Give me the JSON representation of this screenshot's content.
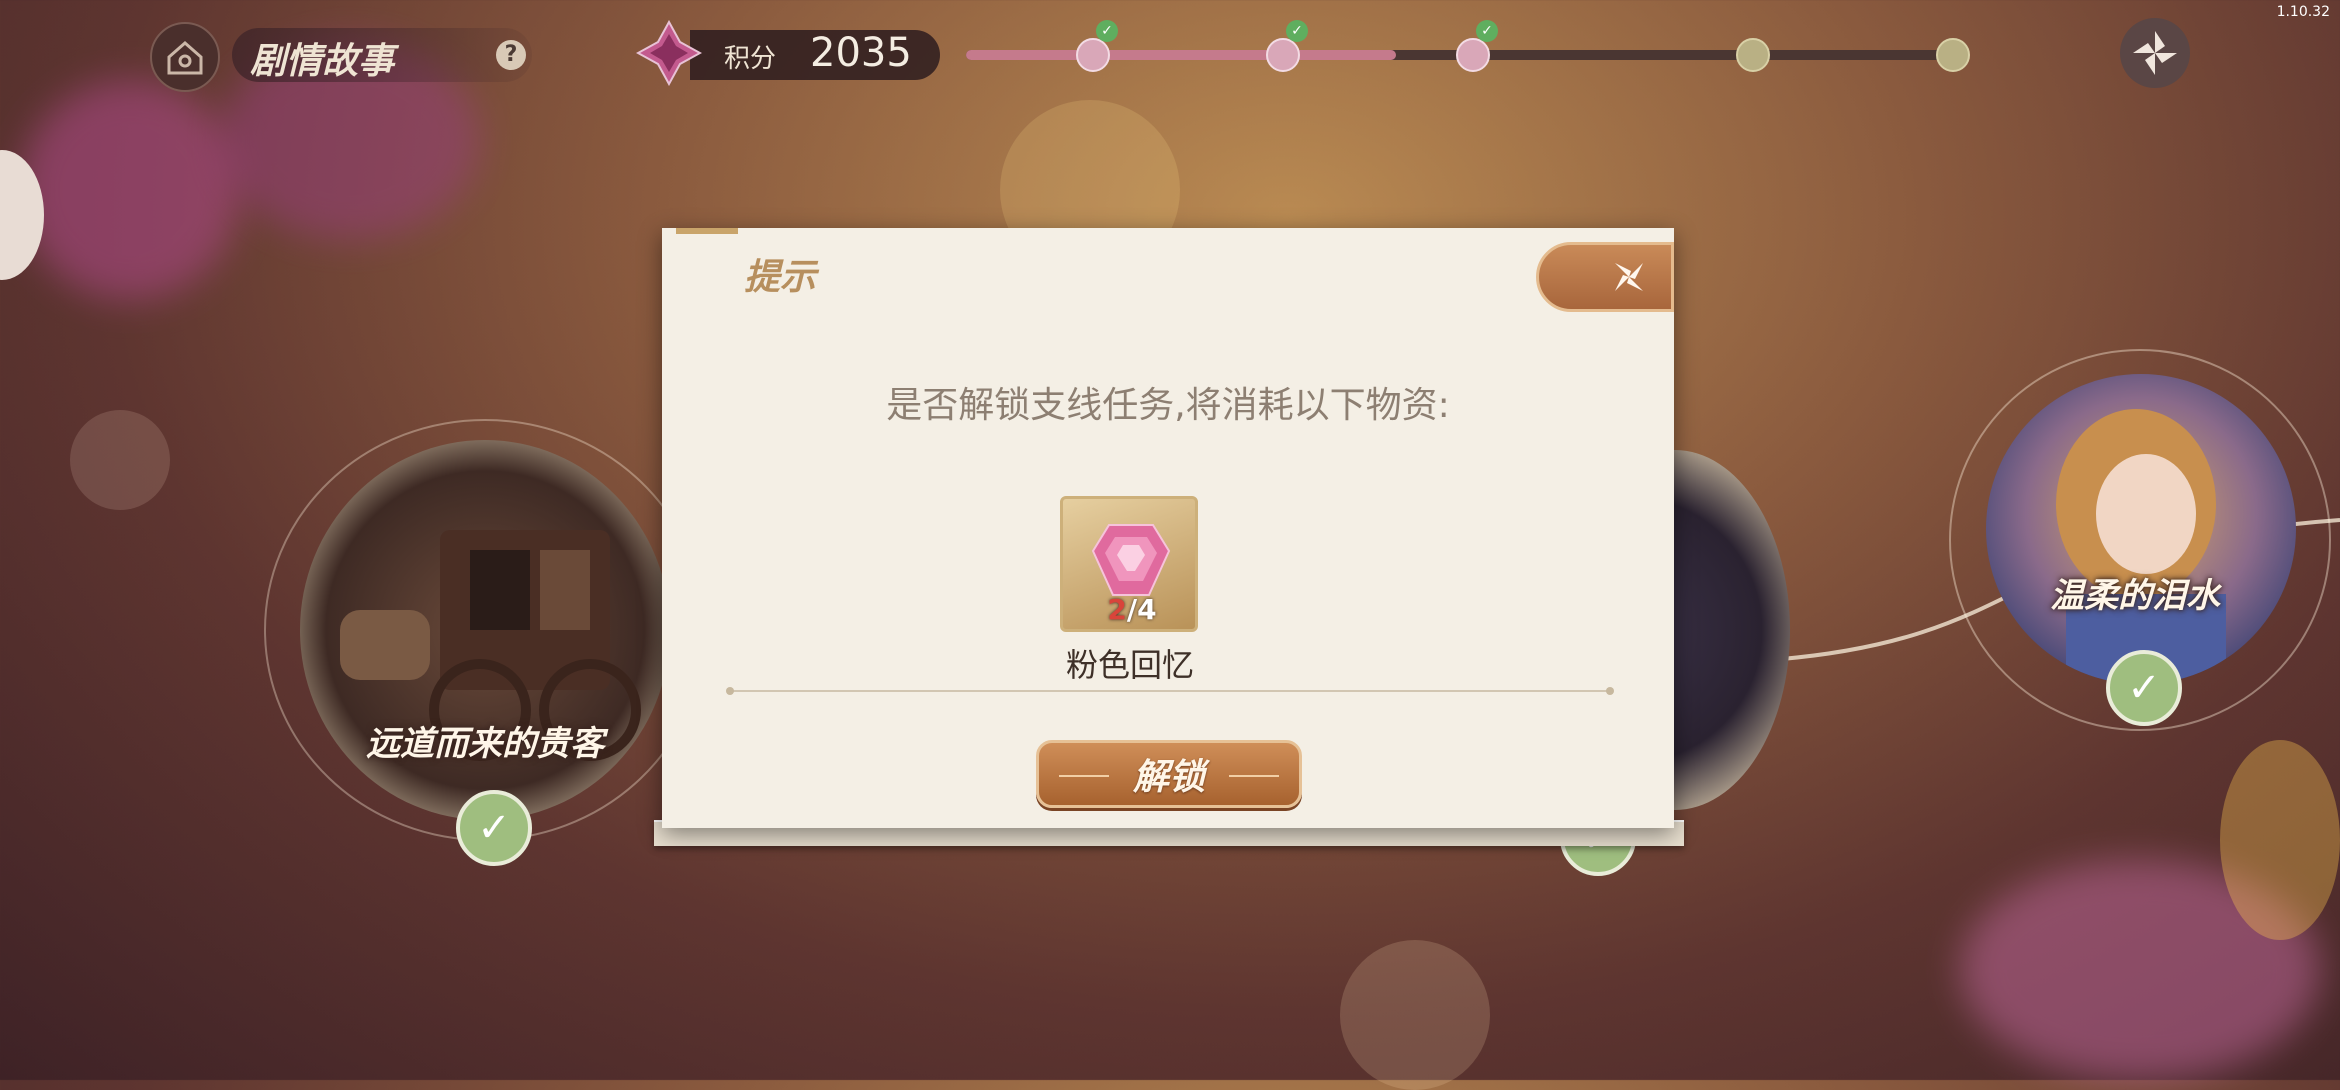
{
  "version": "1.10.32",
  "header": {
    "story_title": "剧情故事",
    "help_symbol": "?",
    "score_label": "积分",
    "score_value": "2035",
    "progress_fraction": 0.43,
    "milestones_completed": 3,
    "milestones_total": 5
  },
  "story_nodes": [
    {
      "label": "远道而来的贵客",
      "completed": true
    },
    {
      "label": "",
      "completed": true
    },
    {
      "label": "温柔的泪水",
      "completed": true
    }
  ],
  "dialog": {
    "title": "提示",
    "message": "是否解锁支线任务,将消耗以下物资:",
    "item": {
      "name": "粉色回忆",
      "have": "2",
      "need": "/4",
      "icon": "pink-gem-icon"
    },
    "confirm_label": "解锁"
  },
  "colors": {
    "dialog_bg": "#f4efe5",
    "title_gold": "#b78f5e",
    "button_orange": "#b8723f",
    "progress_pink": "#c57a8c",
    "count_red": "#d9443a"
  }
}
